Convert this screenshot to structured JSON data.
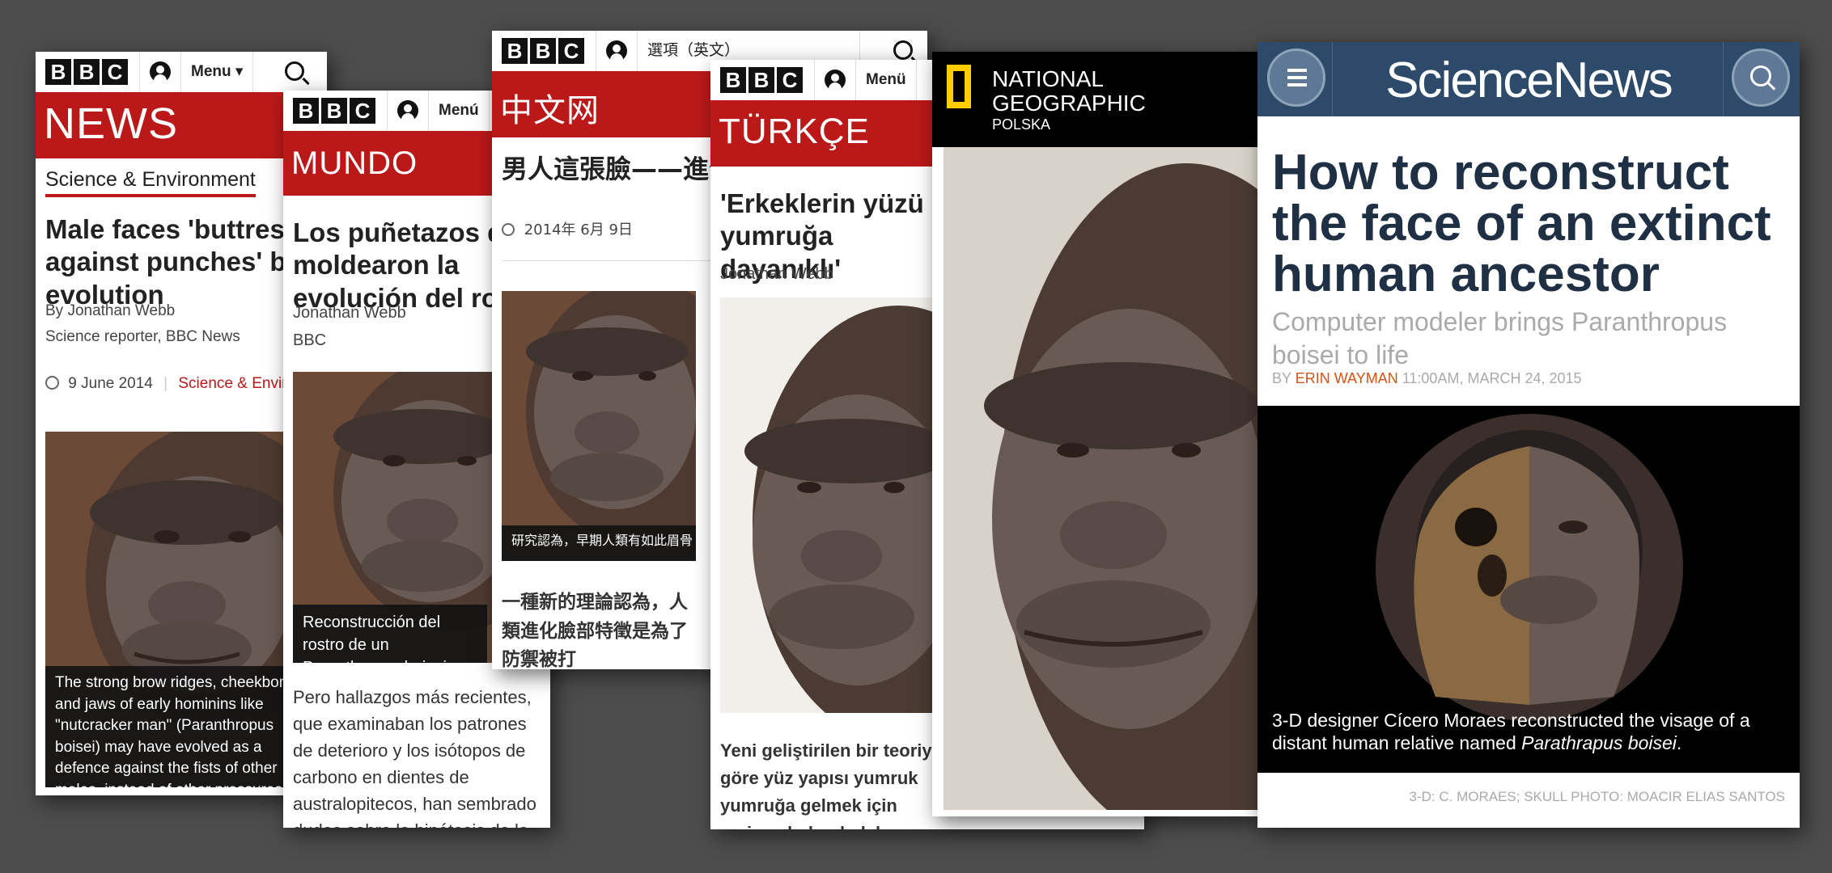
{
  "bbc": {
    "logo_letters": [
      "B",
      "B",
      "C"
    ],
    "search_icon": "search-icon",
    "account_icon": "account-icon"
  },
  "news": {
    "menu": "Menu",
    "brand": "NEWS",
    "section": "Science & Environment",
    "headline": "Male faces 'buttressed against punches' by evolution",
    "byline": "By Jonathan Webb",
    "role": "Science reporter, BBC News",
    "date": "9 June 2014",
    "section_link": "Science & Environment",
    "caption": "The strong brow ridges, cheekbones and jaws of early hominins like \"nutcracker man\" (Paranthropus boisei) may have evolved as a defence against the fists of other males, instead of other pressures such as diet"
  },
  "mundo": {
    "menu": "Menú",
    "brand": "MUNDO",
    "headline": "Los puñetazos que moldearon la evolución del rostro",
    "author": "Jonathan Webb",
    "org": "BBC",
    "caption": "Reconstrucción del rostro de un Paranthropus boisei.",
    "body": "Pero hallazgos más recientes, que examinaban los patrones de deterioro y los isótopos de carbono en dientes de australopitecos, han sembrado dudas sobre la hipótesis de la alimentación."
  },
  "chinese": {
    "menu": "選項（英文）",
    "brand": "中文网",
    "headline": "男人這張臉——進化的結果",
    "date": "2014年 6月 9日",
    "caption": "研究認為，早期人類有如此眉骨",
    "body": "一種新的理論認為，人類進化臉部特徵是為了防禦被打"
  },
  "turkce": {
    "menu": "Menü",
    "brand": "TÜRKÇE",
    "headline": "'Erkeklerin yüzü yumruğa dayanıklı'",
    "author": "Jonathan Webb",
    "body": "Yeni geliştirilen bir teoriye göre yüz yapısı yumruk yumruğa gelmek için evrimsel olarak daha dayanıklı"
  },
  "natgeo": {
    "line1": "NATIONAL",
    "line2": "GEOGRAPHIC",
    "line3": "POLSKA",
    "brand_color": "#ffce00"
  },
  "sciencenews": {
    "logo": "ScienceNews",
    "menu_icon": "hamburger-icon",
    "search_icon": "search-icon",
    "headline": "How to reconstruct the face of an extinct human ancestor",
    "subtitle": "Computer modeler brings Paranthropus boisei to life",
    "by": "BY",
    "author": "ERIN WAYMAN",
    "timestamp": "11:00AM, MARCH 24, 2015",
    "caption_main": "3-D designer Cícero Moraes reconstructed the visage  of a distant human relative named ",
    "caption_italic": "Parathrapus boisei",
    "caption_end": ".",
    "credit": "3-D: C. MORAES; SKULL PHOTO: MOACIR ELIAS SANTOS",
    "header_color": "#2d4a6b",
    "author_color": "#d2521b"
  }
}
